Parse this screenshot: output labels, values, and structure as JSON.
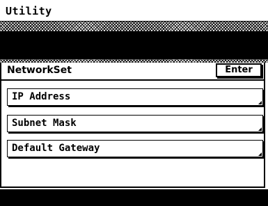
{
  "window": {
    "title": "Utility"
  },
  "section": {
    "title": "NetworkSet",
    "enter_label": "Enter"
  },
  "items": [
    {
      "label": "IP Address",
      "icon": "corner-arrow-icon"
    },
    {
      "label": "Subnet Mask",
      "icon": "corner-arrow-icon"
    },
    {
      "label": "Default Gateway",
      "icon": "corner-arrow-icon"
    }
  ],
  "colors": {
    "foreground": "#000000",
    "background": "#ffffff"
  }
}
